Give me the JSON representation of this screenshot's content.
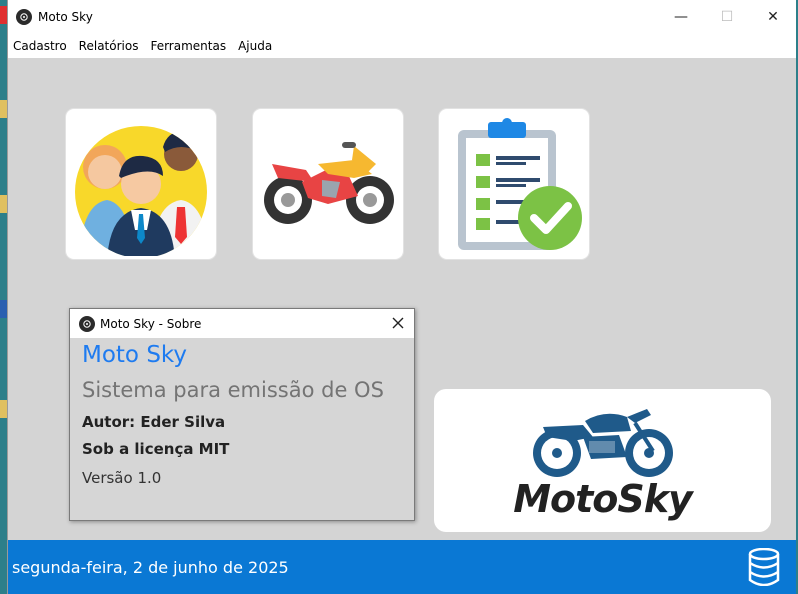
{
  "window": {
    "title": "Moto Sky",
    "controls": {
      "minimize": "—",
      "maximize": "☐",
      "close": "✕"
    }
  },
  "menu": {
    "items": [
      "Cadastro",
      "Relatórios",
      "Ferramentas",
      "Ajuda"
    ]
  },
  "tiles": [
    {
      "icon": "people-icon"
    },
    {
      "icon": "motorcycle-icon"
    },
    {
      "icon": "clipboard-check-icon"
    }
  ],
  "logo": {
    "text": "MotoSky"
  },
  "statusbar": {
    "date": "segunda-feira, 2 de junho de 2025",
    "icon": "database-icon",
    "color": "#0a78d4"
  },
  "about": {
    "title": "Moto Sky - Sobre",
    "app_name": "Moto Sky",
    "description": "Sistema para emissão de OS",
    "author": "Autor: Eder Silva",
    "license": "Sob a licença MIT",
    "version": "Versão 1.0"
  }
}
